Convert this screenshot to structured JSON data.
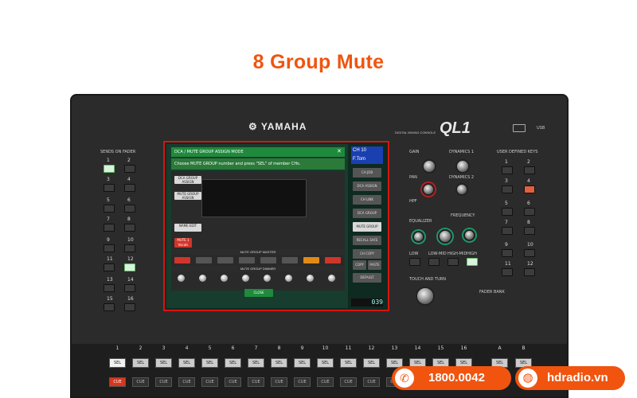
{
  "headline": "8 Group Mute",
  "console": {
    "brand": "YAMAHA",
    "model_caption": "DIGITAL MIXING CONSOLE",
    "model": "QL1",
    "usb_label": "USB",
    "left_section_label": "SENDS ON FADER",
    "right_section_label": "USER DEFINED KEYS",
    "fader_bank_label": "FADER BANK",
    "left_keys": [
      "1",
      "2",
      "3",
      "4",
      "5",
      "6",
      "7",
      "8",
      "9",
      "10",
      "11",
      "12",
      "13",
      "14",
      "15",
      "16"
    ],
    "right_keys": [
      "1",
      "2",
      "3",
      "4",
      "5",
      "6",
      "7",
      "8",
      "9",
      "10",
      "11",
      "12"
    ],
    "selected_channel_labels": {
      "gain": "GAIN",
      "dynamics1": "DYNAMICS 1",
      "pan": "PAN",
      "dynamics2": "DYNAMICS 2",
      "hpf": "HPF",
      "frequency": "FREQUENCY",
      "equalizer": "EQUALIZER",
      "eq_bands": [
        "LOW",
        "LOW-MID",
        "HIGH-MID",
        "HIGH"
      ],
      "touch_and_turn": "TOUCH AND TURN"
    },
    "channel_numbers": [
      "1",
      "2",
      "3",
      "4",
      "5",
      "6",
      "7",
      "8",
      "9",
      "10",
      "11",
      "12",
      "13",
      "14",
      "15",
      "16"
    ],
    "bank_labels": [
      "A",
      "B"
    ],
    "sel_label": "SEL",
    "cue_label": "CUE"
  },
  "screen": {
    "popup_title": "DCA / MUTE GROUP ASSIGN MODE",
    "instruction": "Choose MUTE GROUP number and press \"SEL\" of member CHs.",
    "left_buttons": [
      "DCA GROUP ASSIGN",
      "MUTE GROUP ASSIGN",
      "NAME EDIT",
      "MUTE 1 Vocals"
    ],
    "section_mute_master": "MUTE GROUP MASTER",
    "section_mute_dimmer": "MUTE GROUP DIMMER",
    "close_label": "CLOSE",
    "side_panel_title": "CH 10",
    "side_panel_sub": "F.Tom",
    "side_buttons": [
      "CH JOB",
      "DCA ASSIGN",
      "CH LINK",
      "DCA GROUP",
      "MUTE GROUP",
      "RECALL SAFE",
      "CH COPY",
      "COPY",
      "PASTE",
      "DEFAULT"
    ],
    "scene_display": "039"
  },
  "contact": {
    "phone": "1800.0042",
    "website": "hdradio.vn"
  },
  "colors": {
    "accent": "#f0540f",
    "screen_highlight": "#d8140e",
    "screen_green": "#1f8a3c"
  }
}
